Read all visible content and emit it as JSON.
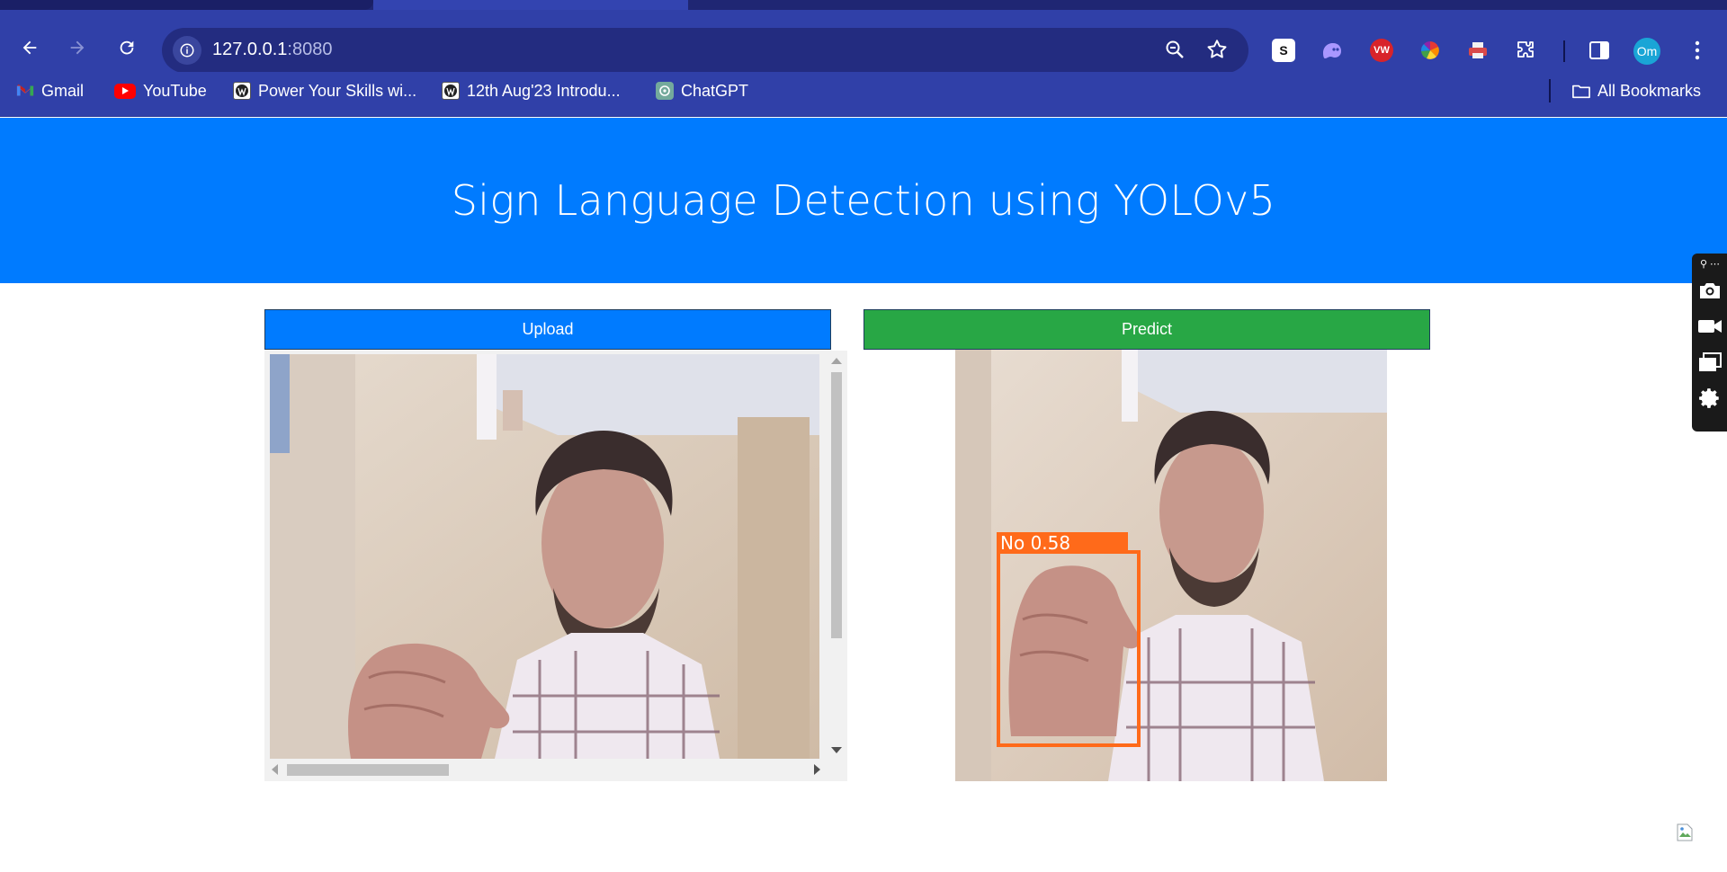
{
  "browser": {
    "address": {
      "host": "127.0.0.1",
      "port": ":8080"
    },
    "profile_initials": "Om",
    "bookmarks": [
      {
        "label": "Gmail",
        "icon": "gmail-icon"
      },
      {
        "label": "YouTube",
        "icon": "youtube-icon"
      },
      {
        "label": "Power Your Skills wi...",
        "icon": "site-favicon"
      },
      {
        "label": "12th Aug'23 Introdu...",
        "icon": "site-favicon"
      },
      {
        "label": "ChatGPT",
        "icon": "chatgpt-icon"
      }
    ],
    "all_bookmarks_label": "All Bookmarks"
  },
  "page": {
    "title": "Sign Language Detection using YOLOv5",
    "upload_label": "Upload",
    "predict_label": "Predict",
    "detection": {
      "label": "No",
      "confidence": "0.58"
    }
  },
  "colors": {
    "header_bg": "#007bff",
    "upload_btn": "#007bff",
    "predict_btn": "#28a745",
    "bbox": "#ff6a1a",
    "chrome_bg": "#3040a8"
  }
}
